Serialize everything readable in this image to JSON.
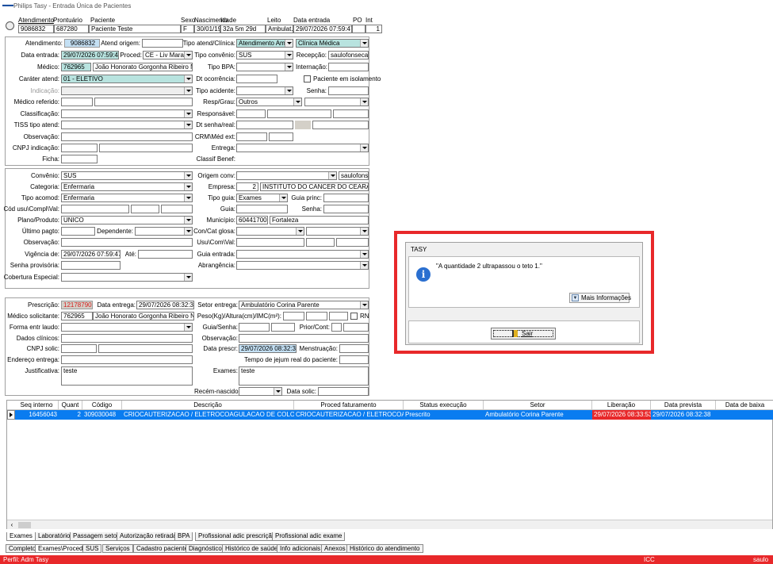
{
  "window": {
    "title": "Philips Tasy - Entrada Única de Pacientes"
  },
  "header": {
    "labels": [
      "Atendimento",
      "Prontuário",
      "Paciente",
      "Sexo",
      "Nascimento",
      "Idade",
      "Leito",
      "Data entrada",
      "PO",
      "Int"
    ],
    "atendimento": "9086832",
    "prontuario": "687280",
    "paciente": "Paciente Teste",
    "sexo": "F",
    "nascimento": "30/01/1994",
    "idade": "32a 5m 29d",
    "leito": "Ambulat.",
    "data_entrada": "29/07/2026 07:59:47",
    "po": "",
    "int": "1"
  },
  "section1": {
    "atendimento_label": "Atendimento:",
    "atendimento": "9086832",
    "atend_origem_label": "Atend origem:",
    "tipo_atend_label": "Tipo atend/Clínica:",
    "tipo_atend": "Atendimento Ambu",
    "clinica": "Clínica Médica",
    "data_entrada_label": "Data entrada:",
    "data_entrada": "29/07/2026 07:59:47",
    "proced_label": "Proced:",
    "proced": "CE - Liv Maraca",
    "tipo_convenio_label": "Tipo convênio:",
    "tipo_convenio": "SUS",
    "recepcao_label": "Recepção:",
    "recepcao": "saulofonseca",
    "medico_label": "Médico:",
    "medico_cod": "762965",
    "medico_nome": "João Honorato Gorgonha Ribeiro Nóbr",
    "tipo_bpa_label": "Tipo BPA:",
    "internacao_label": "Internação:",
    "carater_label": "Caráter atend:",
    "carater": "01 - ELETIVO",
    "dt_ocorrencia_label": "Dt ocorrência:",
    "paciente_isolamento_label": "Paciente em isolamento",
    "indicacao_label": "Indicação:",
    "tipo_acidente_label": "Tipo acidente:",
    "senha_label": "Senha:",
    "medico_ref_label": "Médico referido:",
    "resp_grau_label": "Resp/Grau:",
    "resp_grau": "Outros",
    "classificacao_label": "Classificação:",
    "responsavel_label": "Responsável:",
    "tiss_label": "TISS tipo atend:",
    "dt_senha_label": "Dt senha/real:",
    "observacao_label": "Observação:",
    "crm_label": "CRM\\Méd ext:",
    "cnpj_label": "CNPJ indicação:",
    "entrega_label": "Entrega:",
    "ficha_label": "Ficha:",
    "classif_benef_label": "Classif Benef:"
  },
  "section2": {
    "convenio_label": "Convênio:",
    "convenio": "SUS",
    "origem_conv_label": "Origem conv:",
    "usuario": "saulofonsec",
    "categoria_label": "Categoria:",
    "categoria": "Enfermaria",
    "empresa_label": "Empresa:",
    "empresa_cod": "2",
    "empresa_nome": "INSTITUTO DO CANCER DO CEARA",
    "tipo_acomod_label": "Tipo acomod:",
    "tipo_acomod": "Enfermaria",
    "tipo_guia_label": "Tipo guia:",
    "tipo_guia": "Exames",
    "guia_princ_label": "Guia princ:",
    "cod_usu_label": "Cód usu\\Compl\\Val:",
    "guia_label": "Guia:",
    "senha_label": "Senha:",
    "plano_label": "Plano/Produto:",
    "plano": "UNICO",
    "municipio_label": "Município:",
    "municipio_cod": "60441700",
    "municipio_nome": "Fortaleza",
    "ultimo_pagto_label": "Último pagto:",
    "dependente_label": "Dependente:",
    "con_cat_label": "Con/Cat glosa:",
    "observacao_label": "Observação:",
    "usu_com_label": "Usu\\Com\\Val:",
    "vigencia_label": "Vigência de:",
    "vigencia": "29/07/2026 07:59:47",
    "ate_label": "Até:",
    "guia_entrada_label": "Guia entrada:",
    "senha_prov_label": "Senha provisória:",
    "abrangencia_label": "Abrangência:",
    "cobertura_label": "Cobertura Especial:"
  },
  "section3": {
    "prescricao_label": "Prescrição:",
    "prescricao": "12178790",
    "data_entrega_label": "Data entrega:",
    "data_entrega": "29/07/2026 08:32:38",
    "setor_entrega_label": "Setor entrega:",
    "setor_entrega": "Ambulatório Corina Parente",
    "med_solic_label": "Médico solicitante:",
    "med_solic_cod": "762965",
    "med_solic_nome": "João Honorato Gorgonha Ribeiro Nóbr",
    "peso_label": "Peso(Kg)/Altura(cm)/IMC(m²):",
    "rn_label": "RN",
    "forma_laudo_label": "Forma entr laudo:",
    "guia_senha_label": "Guia/Senha:",
    "prior_cont_label": "Prior/Cont:",
    "dados_clinicos_label": "Dados clínicos:",
    "observacao_label": "Observação:",
    "cnpj_solic_label": "CNPJ solic:",
    "data_prescr_label": "Data prescr:",
    "data_prescr": "29/07/2026 08:32:38",
    "menstruacao_label": "Menstruação:",
    "endereco_label": "Endereço entrega:",
    "jejum_label": "Tempo de jejum real do paciente:",
    "justificativa_label": "Justificativa:",
    "justificativa": "teste",
    "exames_label": "Exames:",
    "exames": "teste",
    "recem_nascido_label": "Recém-nascido:",
    "data_solic_label": "Data solic:"
  },
  "dialog": {
    "title": "TASY",
    "message": "\"A quantidade 2 ultrapassou o teto 1.\"",
    "more_info": "Mais Informações",
    "exit_button": "Sair"
  },
  "table": {
    "columns": [
      "Seq interno",
      "Quant",
      "Código",
      "Descrição",
      "Proced faturamento",
      "Status execução",
      "Setor",
      "Liberação",
      "Data prevista",
      "Data de baixa"
    ],
    "rows": [
      {
        "seq": "16456043",
        "quant": "2",
        "codigo": "309030048",
        "descricao": "CRIOCAUTERIZACAO / ELETROCOAGULACAO DE COLO DE UT",
        "proced": "CRIOCAUTERIZACAO / ELETROCOAGUL",
        "status": "Prescrito",
        "setor": "Ambulatório Corina Parente",
        "liberacao": "29/07/2026 08:33:53",
        "data_prevista": "29/07/2026 08:32:38",
        "data_baixa": ""
      }
    ]
  },
  "tabs_row1": [
    "Exames",
    "Laboratório",
    "Passagem setor",
    "Autorização retirada",
    "BPA",
    "Profissional adic prescrição",
    "Profissional adic exame"
  ],
  "tabs_row2": [
    "Completo",
    "Exames\\Proced",
    "SUS",
    "Serviços",
    "Cadastro paciente",
    "Diagnóstico",
    "Histórico de saúde",
    "Info adicionais",
    "Anexos",
    "Histórico do atendimento"
  ],
  "status_bar": {
    "left": "Perfil: Adm Tasy",
    "mid": "ICC",
    "right": "saulo"
  },
  "colors": {
    "highlight_red": "#e8282a",
    "selection_blue": "#0a7cf0",
    "teal_field": "#b8e3df",
    "gray_panel": "#d4d0c8"
  }
}
